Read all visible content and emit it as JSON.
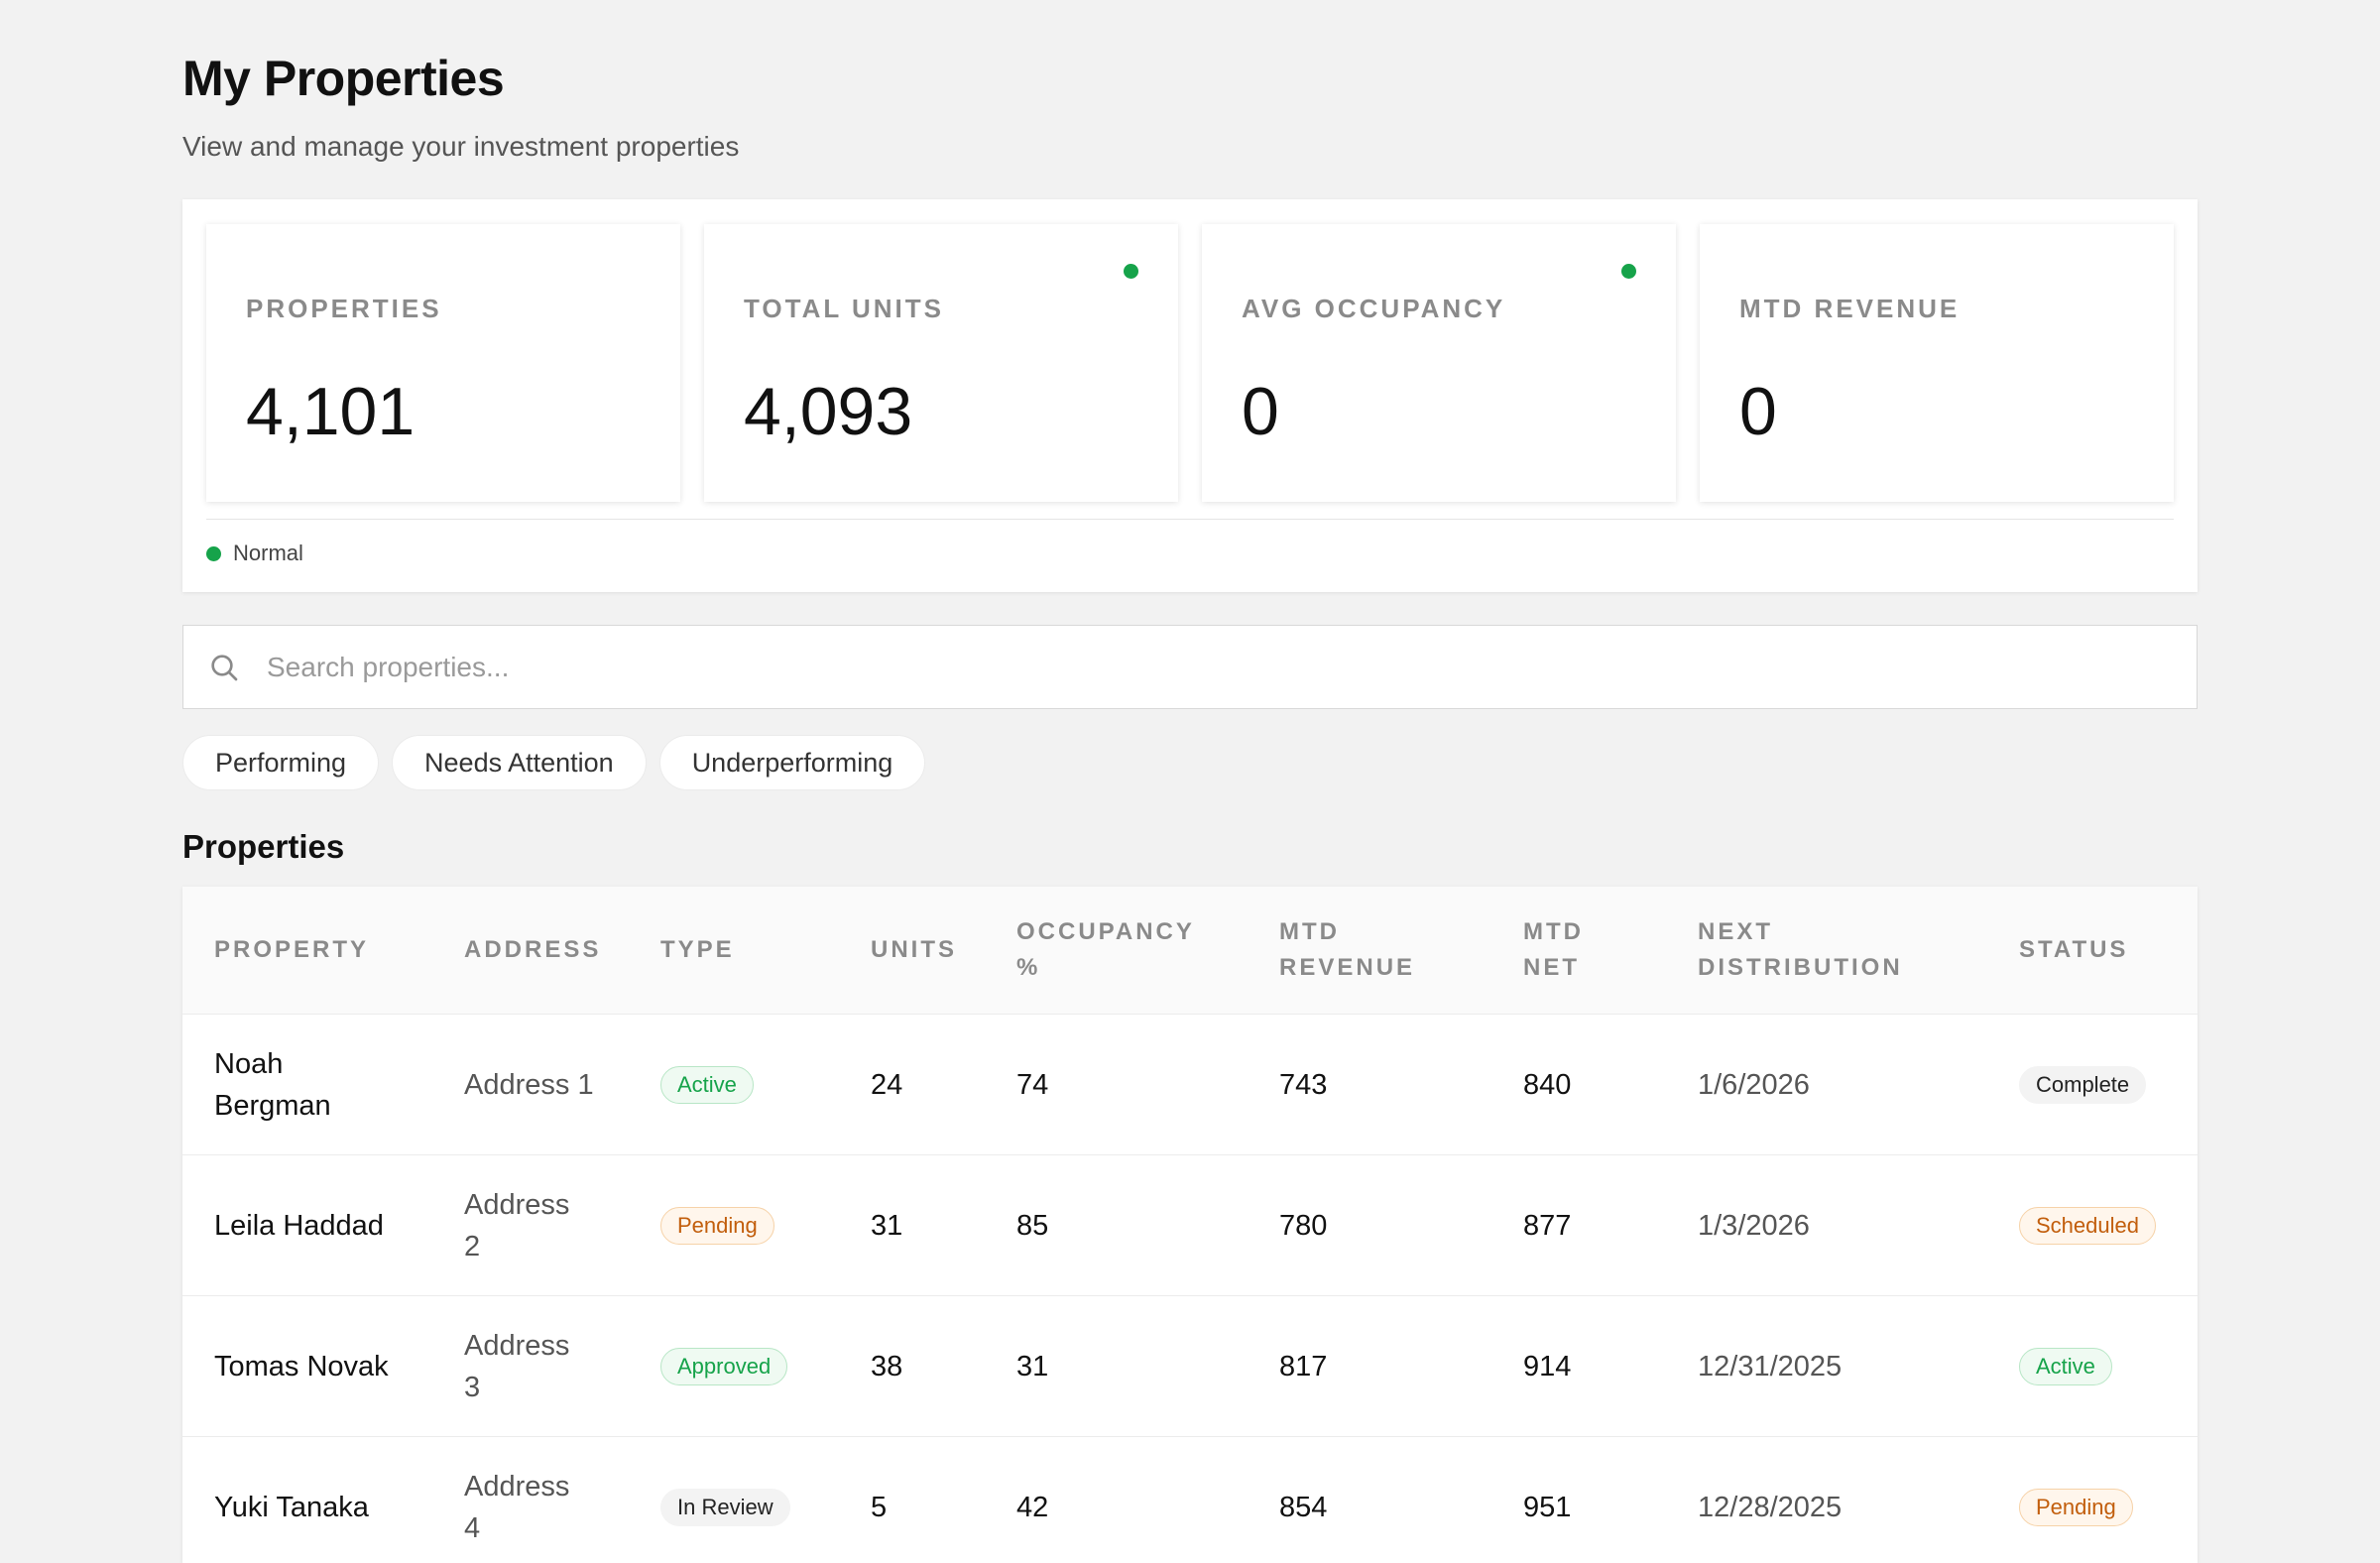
{
  "header": {
    "title": "My Properties",
    "subtitle": "View and manage your investment properties"
  },
  "stats": [
    {
      "label": "PROPERTIES",
      "value": "4,101",
      "indicator": false
    },
    {
      "label": "TOTAL UNITS",
      "value": "4,093",
      "indicator": true
    },
    {
      "label": "AVG OCCUPANCY",
      "value": "0",
      "indicator": true
    },
    {
      "label": "MTD REVENUE",
      "value": "0",
      "indicator": false
    }
  ],
  "legend": {
    "label": "Normal",
    "color": "#16a34a"
  },
  "search": {
    "placeholder": "Search properties...",
    "value": ""
  },
  "filters": [
    "Performing",
    "Needs Attention",
    "Underperforming"
  ],
  "table": {
    "title": "Properties",
    "columns": [
      {
        "line1": "PROPERTY",
        "line2": ""
      },
      {
        "line1": "ADDRESS",
        "line2": ""
      },
      {
        "line1": "TYPE",
        "line2": ""
      },
      {
        "line1": "UNITS",
        "line2": ""
      },
      {
        "line1": "OCCUPANCY",
        "line2": "%"
      },
      {
        "line1": "MTD",
        "line2": "REVENUE"
      },
      {
        "line1": "MTD",
        "line2": "NET"
      },
      {
        "line1": "NEXT",
        "line2": "DISTRIBUTION"
      },
      {
        "line1": "STATUS",
        "line2": ""
      }
    ],
    "rows": [
      {
        "property": {
          "line1": "Noah",
          "line2": "Bergman"
        },
        "address": {
          "line1": "Address 1",
          "line2": ""
        },
        "type": {
          "label": "Active",
          "tone": "green"
        },
        "units": "24",
        "occupancy": "74",
        "mtd_revenue": "743",
        "mtd_net": "840",
        "next_distribution": "1/6/2026",
        "status": {
          "label": "Complete",
          "tone": "gray"
        }
      },
      {
        "property": {
          "line1": "Leila Haddad",
          "line2": ""
        },
        "address": {
          "line1": "Address",
          "line2": "2"
        },
        "type": {
          "label": "Pending",
          "tone": "orange"
        },
        "units": "31",
        "occupancy": "85",
        "mtd_revenue": "780",
        "mtd_net": "877",
        "next_distribution": "1/3/2026",
        "status": {
          "label": "Scheduled",
          "tone": "orange"
        }
      },
      {
        "property": {
          "line1": "Tomas Novak",
          "line2": ""
        },
        "address": {
          "line1": "Address",
          "line2": "3"
        },
        "type": {
          "label": "Approved",
          "tone": "green"
        },
        "units": "38",
        "occupancy": "31",
        "mtd_revenue": "817",
        "mtd_net": "914",
        "next_distribution": "12/31/2025",
        "status": {
          "label": "Active",
          "tone": "green"
        }
      },
      {
        "property": {
          "line1": "Yuki Tanaka",
          "line2": ""
        },
        "address": {
          "line1": "Address",
          "line2": "4"
        },
        "type": {
          "label": "In Review",
          "tone": "gray"
        },
        "units": "5",
        "occupancy": "42",
        "mtd_revenue": "854",
        "mtd_net": "951",
        "next_distribution": "12/28/2025",
        "status": {
          "label": "Pending",
          "tone": "orange"
        }
      }
    ]
  }
}
